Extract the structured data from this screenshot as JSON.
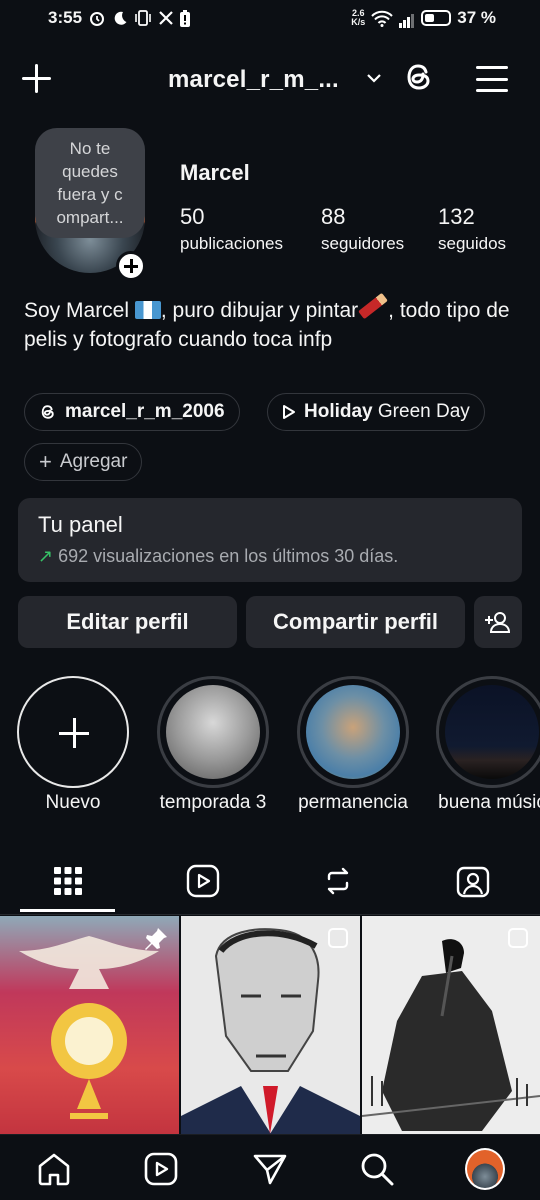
{
  "status_bar": {
    "time": "3:55",
    "net_speed_value": "2.6",
    "net_speed_unit": "K/s",
    "battery": "37 %"
  },
  "header": {
    "username": "marcel_r_m_...",
    "icons": [
      "plus-icon",
      "chevron-down-icon",
      "threads-icon",
      "menu-icon"
    ]
  },
  "profile": {
    "note_bubble": "No te quedes fuera y c ompart...",
    "name": "Marcel",
    "stats": [
      {
        "value": "50",
        "label": "publicaciones"
      },
      {
        "value": "88",
        "label": "seguidores"
      },
      {
        "value": "132",
        "label": "seguidos"
      }
    ],
    "bio_part1": "Soy Marcel ",
    "bio_part2": ", puro dibujar y pintar",
    "bio_part3": ", todo tipo de pelis y fotografo cuando toca infp",
    "threads_chip": "marcel_r_m_2006",
    "music_chip_song": "Holiday",
    "music_chip_artist": "Green Day",
    "add_chip": "Agregar"
  },
  "dashboard": {
    "title": "Tu panel",
    "stats_text": "692 visualizaciones en los últimos 30 días."
  },
  "buttons": {
    "edit": "Editar perfil",
    "share": "Compartir perfil"
  },
  "highlights": [
    {
      "label": "Nuevo"
    },
    {
      "label": "temporada 3"
    },
    {
      "label": "permanencia"
    },
    {
      "label": "buena músic"
    }
  ],
  "tabs": [
    "grid-icon",
    "reels-icon",
    "reposts-icon",
    "tagged-icon"
  ],
  "bottom_nav": [
    "home-icon",
    "reels-icon",
    "send-icon",
    "search-icon",
    "profile-avatar"
  ],
  "colors": {
    "background": "#0c0f14",
    "card": "#25272d",
    "trend_green": "#37c267"
  }
}
